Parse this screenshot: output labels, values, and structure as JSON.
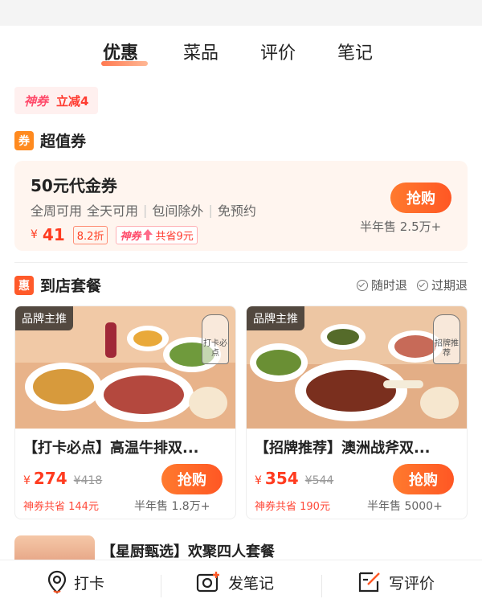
{
  "tabs": [
    {
      "label": "优惠",
      "active": true
    },
    {
      "label": "菜品",
      "active": false
    },
    {
      "label": "评价",
      "active": false
    },
    {
      "label": "笔记",
      "active": false
    }
  ],
  "promo": {
    "brand": "神券",
    "text": "立减4"
  },
  "voucher_section": {
    "badge": "券",
    "title": "超值券",
    "badge_color": "#ff8a1f"
  },
  "voucher": {
    "title": "50元代金券",
    "tags": [
      "全周可用",
      "全天可用",
      "包间除外",
      "免预约"
    ],
    "currency": "¥",
    "price": "41",
    "discount": "8.2折",
    "saving_brand": "神券",
    "saving_text": "共省9元",
    "button": "抢购",
    "sold": "半年售 2.5万+"
  },
  "package_section": {
    "badge": "惠",
    "title": "到店套餐",
    "badge_color": "#ff5a2a",
    "refund_flags": [
      "随时退",
      "过期退"
    ]
  },
  "packages": [
    {
      "tag": "品牌主推",
      "stamp": "打卡必点",
      "title": "【打卡必点】高温牛排双...",
      "currency": "¥",
      "price": "274",
      "original": "¥418",
      "saving": "神券共省 144元",
      "button": "抢购",
      "sold": "半年售 1.8万+"
    },
    {
      "tag": "品牌主推",
      "stamp": "招牌推荐",
      "title": "【招牌推荐】澳洲战斧双...",
      "currency": "¥",
      "price": "354",
      "original": "¥544",
      "saving": "神券共省 190元",
      "button": "抢购",
      "sold": "半年售 5000+"
    }
  ],
  "next_package": {
    "title": "【星厨甄选】欢聚四人套餐"
  },
  "bottom_bar": [
    {
      "icon": "location-pin-icon",
      "label": "打卡"
    },
    {
      "icon": "camera-plus-icon",
      "label": "发笔记"
    },
    {
      "icon": "edit-review-icon",
      "label": "写评价"
    }
  ],
  "colors": {
    "accent": "#ff5724",
    "price": "#ff3b1f"
  }
}
